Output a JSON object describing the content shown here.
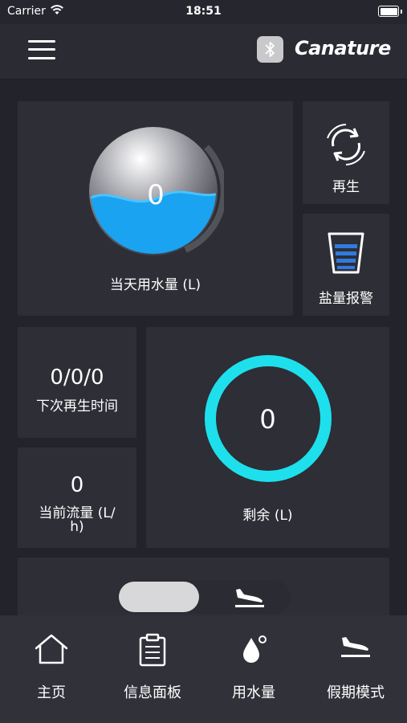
{
  "status_bar": {
    "carrier": "Carrier",
    "time": "18:51"
  },
  "header": {
    "brand": "Canature",
    "menu_icon": "hamburger-icon",
    "bluetooth_icon": "bluetooth-icon"
  },
  "cards": {
    "daily_usage": {
      "value": "0",
      "label": "当天用水量 (L)"
    },
    "regenerate": {
      "label": "再生"
    },
    "salt_alarm": {
      "label": "盐量报警"
    },
    "next_regen": {
      "value": "0/0/0",
      "label": "下次再生时间"
    },
    "current_flow": {
      "value": "0",
      "label_line1": "当前流量 (L/",
      "label_line2": "h)"
    },
    "remaining": {
      "value": "0",
      "label": "剩余 (L)"
    }
  },
  "vacation_toggle": {
    "state": "off",
    "icon": "airplane-landing-icon"
  },
  "tabs": [
    {
      "label": "主页",
      "icon": "home-icon"
    },
    {
      "label": "信息面板",
      "icon": "clipboard-icon"
    },
    {
      "label": "用水量",
      "icon": "water-drop-icon"
    },
    {
      "label": "假期模式",
      "icon": "airplane-landing-icon"
    }
  ],
  "colors": {
    "background": "#23242b",
    "card": "#2d2e36",
    "ring": "#1ee0ec",
    "water": "#1aa3f0"
  }
}
